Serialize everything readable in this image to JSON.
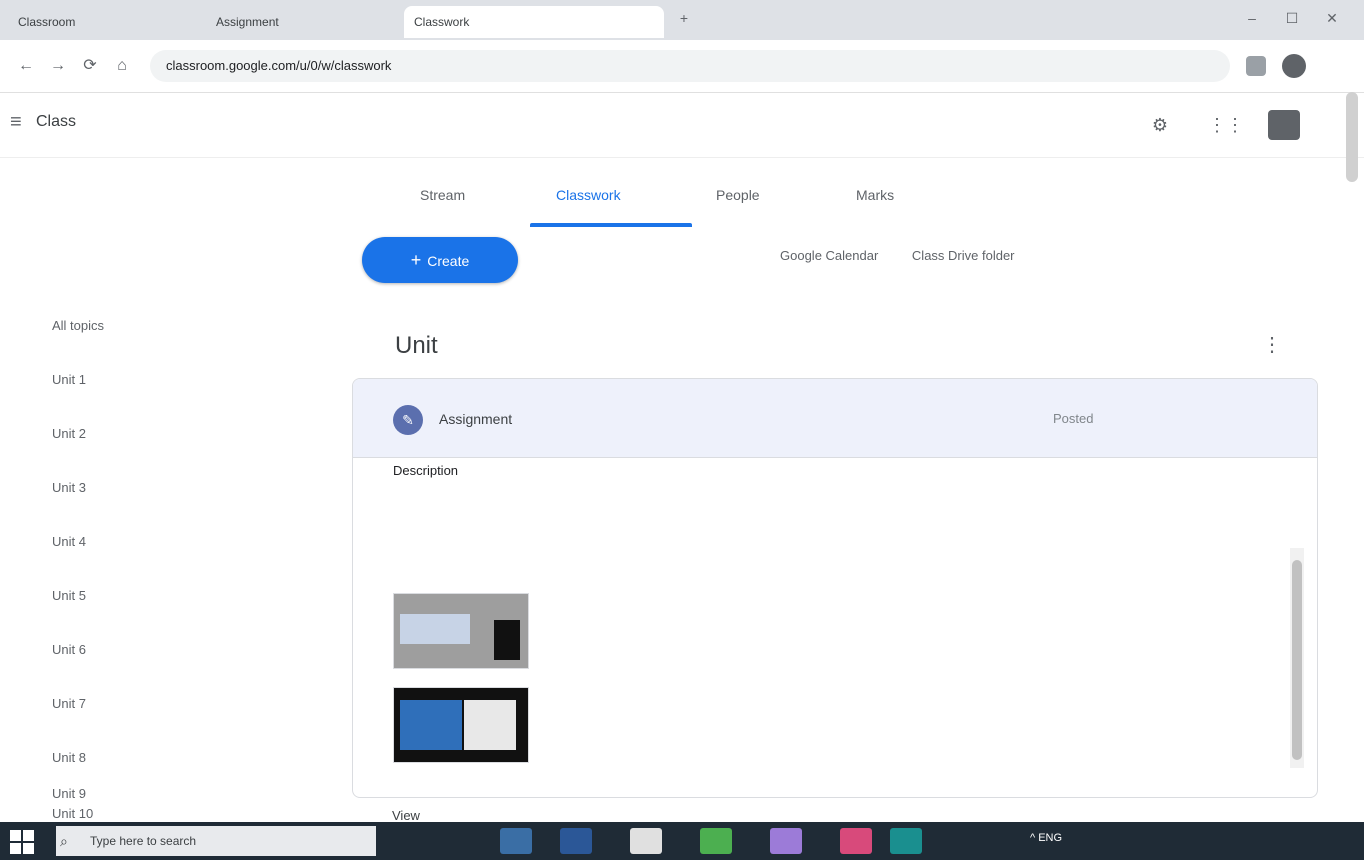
{
  "browser": {
    "tabs": [
      {
        "label": "Classroom",
        "active": false
      },
      {
        "label": "Assignment",
        "active": false
      },
      {
        "label": "Classwork",
        "active": true
      }
    ],
    "new_tab": "+",
    "window_controls": {
      "minimize": "–",
      "maximize": "☐",
      "close": "✕"
    },
    "nav": {
      "back": "←",
      "forward": "→",
      "reload": "⟳",
      "home": "⌂"
    },
    "url": "classroom.google.com/u/0/w/classwork",
    "ext_icons": [
      "extension-icon",
      "profile-icon"
    ]
  },
  "app": {
    "menu_glyph": "≡",
    "title": "Class",
    "header_icons": {
      "settings": "⚙",
      "apps": "⋮⋮",
      "account": ""
    }
  },
  "class_tabs": [
    {
      "label": "Stream",
      "active": false
    },
    {
      "label": "Classwork",
      "active": true
    },
    {
      "label": "People",
      "active": false
    },
    {
      "label": "Marks",
      "active": false
    }
  ],
  "actions": {
    "create_plus": "+",
    "create_label": "Create",
    "google_calendar": "Google Calendar",
    "class_drive": "Class Drive folder"
  },
  "sidebar": {
    "items": [
      "All topics",
      "Unit 1",
      "Unit 2",
      "Unit 3",
      "Unit 4",
      "Unit 5",
      "Unit 6",
      "Unit 7",
      "Unit 8",
      "Unit 9",
      "Unit 10"
    ]
  },
  "topic": {
    "title": "Unit",
    "menu_glyph": "⋮"
  },
  "assignment": {
    "icon_glyph": "✎",
    "title": "Assignment",
    "posted": "Posted",
    "description_label": "Description",
    "description_lines": [
      "",
      "",
      "",
      ""
    ],
    "attachments": [
      {
        "name": "",
        "sub": "",
        "mid": "",
        "right": ""
      },
      {
        "name": "",
        "sub": "",
        "mid": "",
        "right": ""
      }
    ],
    "more_label": "View"
  },
  "taskbar": {
    "search_glyph": "⌕",
    "search_placeholder": "Type here to search",
    "tray": "^ ENG",
    "time": "",
    "date": ""
  },
  "colors": {
    "accent": "#1a73e8",
    "card_header": "#eef1fb",
    "taskbar": "#1f2b36"
  }
}
